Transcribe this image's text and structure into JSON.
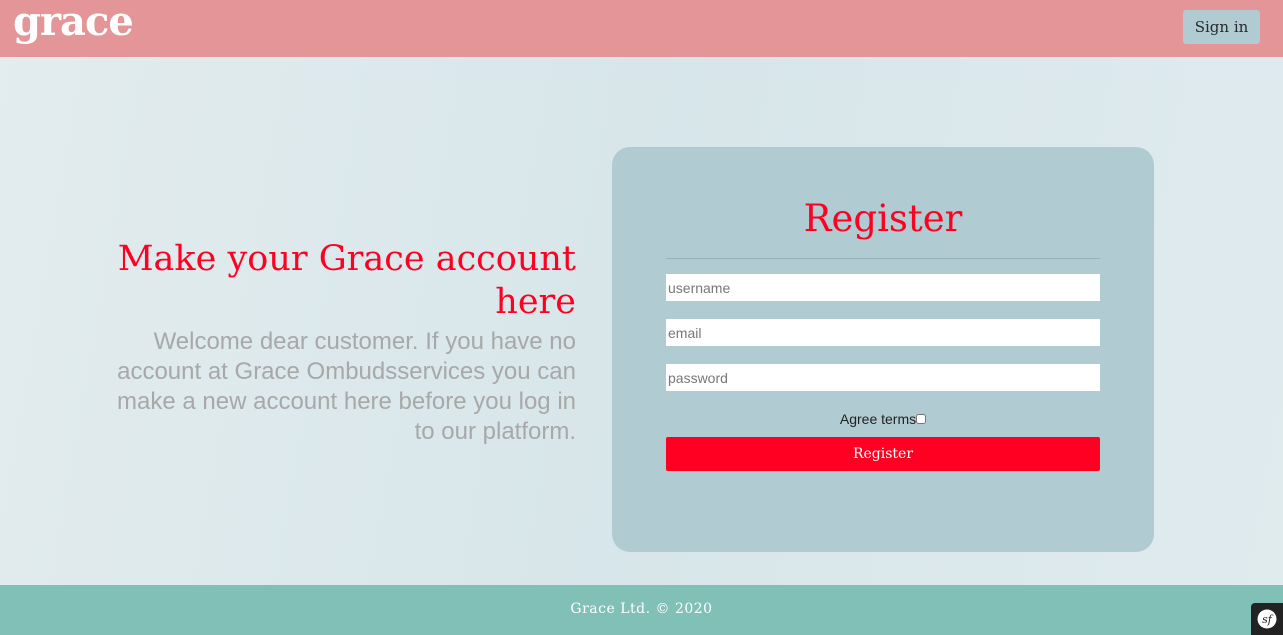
{
  "header": {
    "logo_text": "grace",
    "signin_label": "Sign in",
    "background_color": "#e49597"
  },
  "hero": {
    "title": "Make your Grace account here",
    "text": "Welcome dear customer. If you have no account at Grace Ombudsservices you can make a new account here before you log in to our platform."
  },
  "register_form": {
    "title": "Register",
    "username_placeholder": "username",
    "email_placeholder": "email",
    "password_placeholder": "password",
    "agree_label": "Agree terms",
    "agree_checked": false,
    "submit_label": "Register",
    "accent_color": "#ff0022",
    "card_color": "#b1cbd2"
  },
  "footer": {
    "text": "Grace Ltd. © 2020",
    "background_color": "#80c0b6"
  },
  "debug_toolbar": {
    "icon": "symfony-icon"
  }
}
